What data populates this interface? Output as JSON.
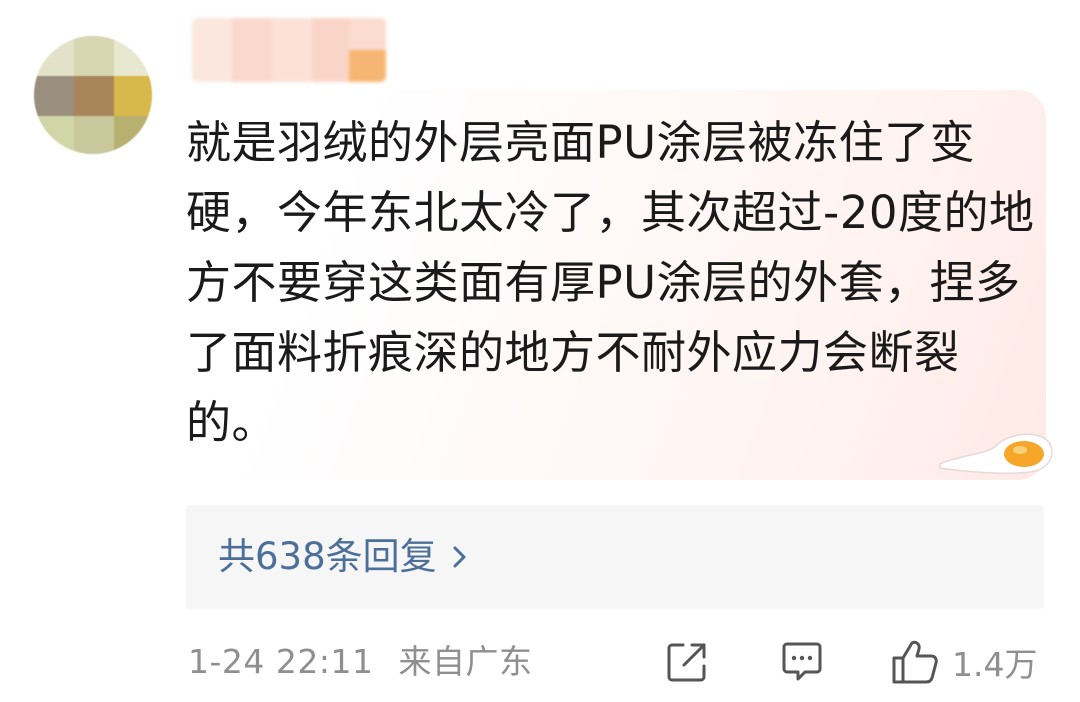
{
  "comment": {
    "text": "就是羽绒的外层亮面PU涂层被冻住了变硬，今年东北太冷了，其次超过-20度的地方不要穿这类面有厚PU涂层的外套，捏多了面料折痕深的地方不耐外应力会断裂的。",
    "timestamp": "1-24 22:11",
    "location": "来自广东"
  },
  "replies": {
    "label": "共638条回复"
  },
  "actions": {
    "like_count": "1.4万"
  },
  "icons": {
    "reply_chevron": "chevron-right-icon",
    "share": "share-icon",
    "comment": "comment-icon",
    "like": "thumbs-up-icon"
  },
  "colors": {
    "link": "#4c6f9a",
    "meta": "#8f8f8f",
    "text": "#1a1a1a"
  }
}
